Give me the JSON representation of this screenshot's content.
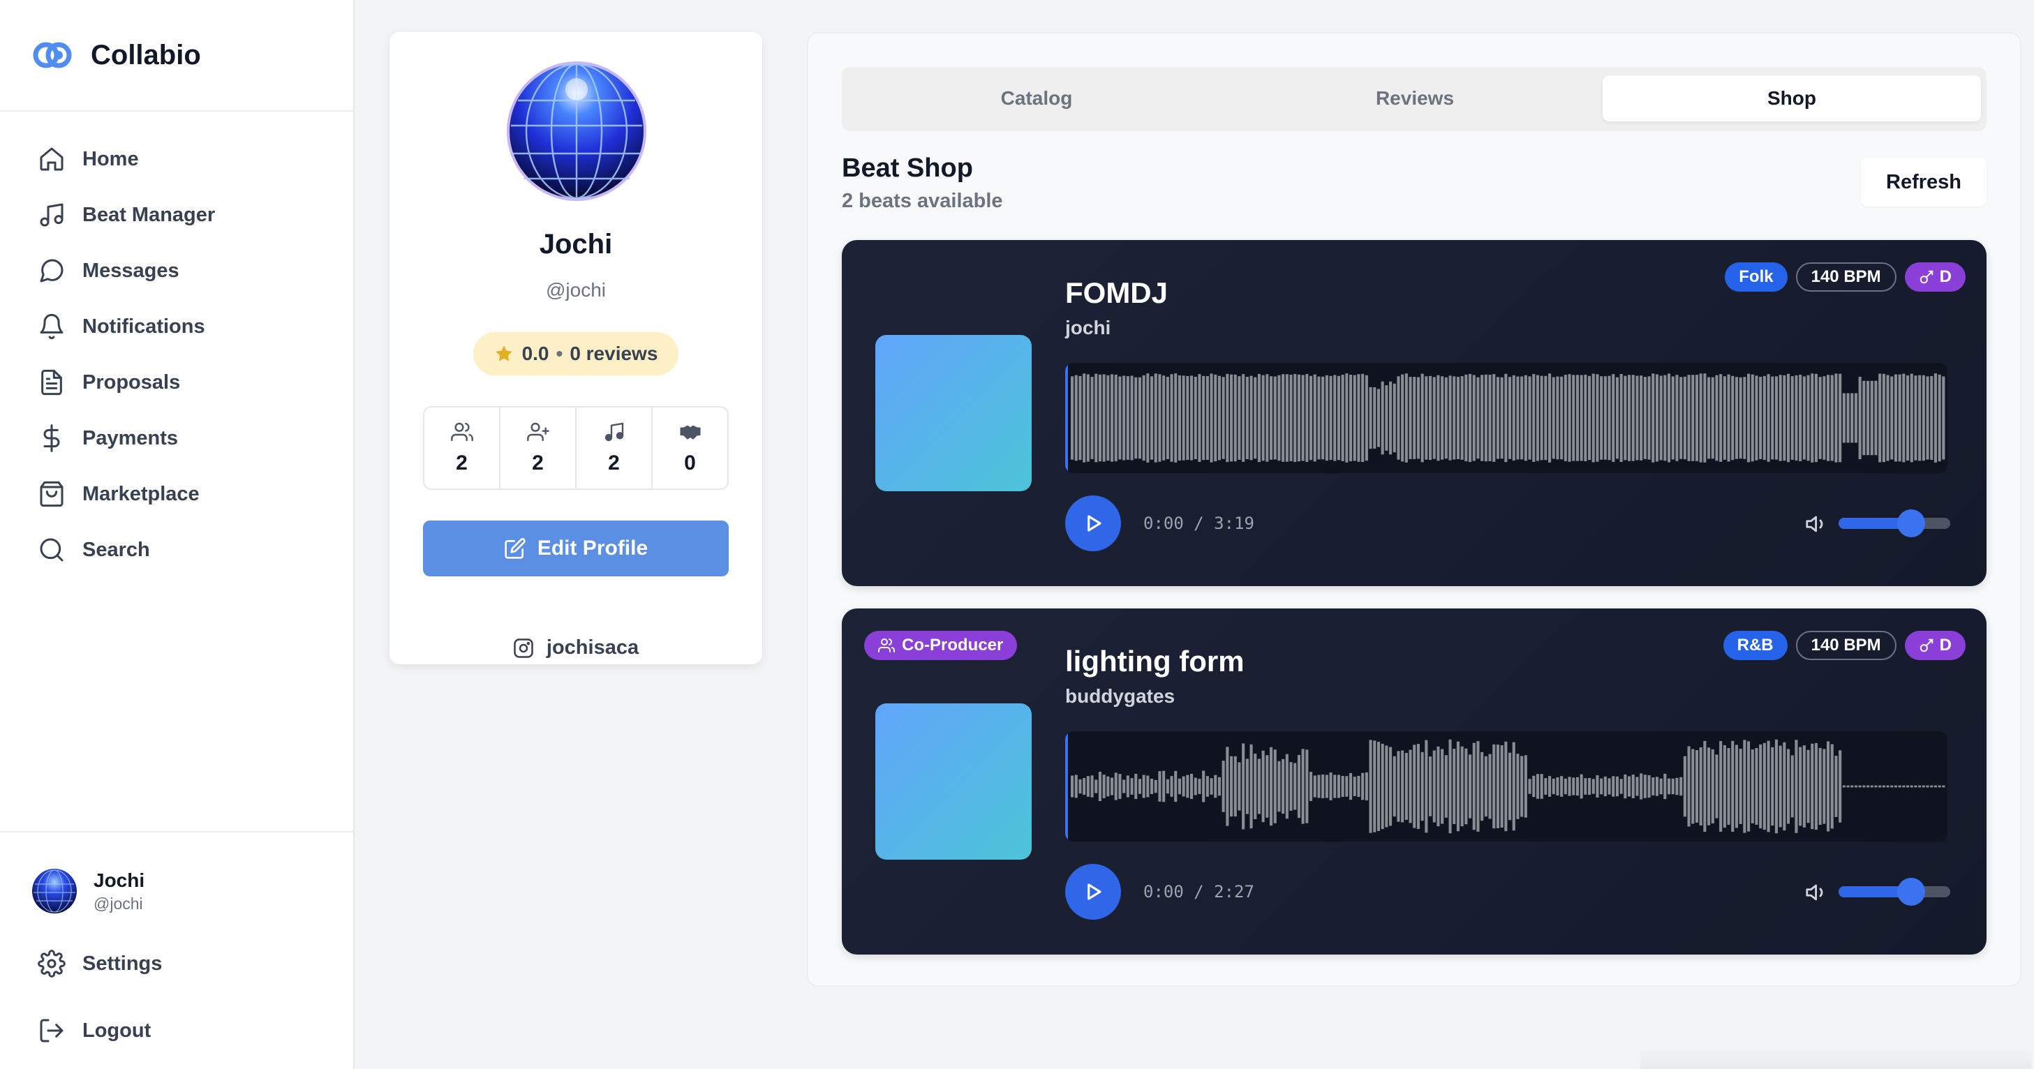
{
  "app": {
    "name": "Collabio"
  },
  "sidebar": {
    "items": [
      {
        "label": "Home",
        "icon": "home-icon"
      },
      {
        "label": "Beat Manager",
        "icon": "music-note-icon"
      },
      {
        "label": "Messages",
        "icon": "message-circle-icon"
      },
      {
        "label": "Notifications",
        "icon": "bell-icon"
      },
      {
        "label": "Proposals",
        "icon": "document-icon"
      },
      {
        "label": "Payments",
        "icon": "dollar-icon"
      },
      {
        "label": "Marketplace",
        "icon": "shopping-bag-icon"
      },
      {
        "label": "Search",
        "icon": "search-icon"
      }
    ],
    "user": {
      "name": "Jochi",
      "handle": "@jochi"
    },
    "settings_label": "Settings",
    "logout_label": "Logout"
  },
  "profile": {
    "name": "Jochi",
    "handle": "@jochi",
    "rating": "0.0",
    "rating_separator": "•",
    "reviews": "0 reviews",
    "stats": [
      {
        "icon": "followers-icon",
        "value": "2"
      },
      {
        "icon": "following-icon",
        "value": "2"
      },
      {
        "icon": "music-note-icon",
        "value": "2"
      },
      {
        "icon": "handshake-icon",
        "value": "0"
      }
    ],
    "edit_label": "Edit Profile",
    "instagram": "jochisaca"
  },
  "tabs": [
    {
      "label": "Catalog",
      "active": false
    },
    {
      "label": "Reviews",
      "active": false
    },
    {
      "label": "Shop",
      "active": true
    }
  ],
  "shop": {
    "title": "Beat Shop",
    "subtitle": "2 beats available",
    "refresh_label": "Refresh",
    "beats": [
      {
        "title": "FOMDJ",
        "artist": "jochi",
        "genre": "Folk",
        "bpm": "140 BPM",
        "key": "D",
        "time": "0:00 / 3:19",
        "volume": 0.65,
        "co_producer": null
      },
      {
        "title": "lighting form",
        "artist": "buddygates",
        "genre": "R&B",
        "bpm": "140 BPM",
        "key": "D",
        "time": "0:00 / 2:27",
        "volume": 0.65,
        "co_producer": "Co-Producer"
      }
    ]
  },
  "colors": {
    "accent": "#2f67e8",
    "edit_button": "#5b8fe3",
    "genre_badge": "#2563eb",
    "key_badge": "#8b3fd9",
    "rating_bg": "#fdf0c6",
    "card_bg": "#1a2032"
  }
}
